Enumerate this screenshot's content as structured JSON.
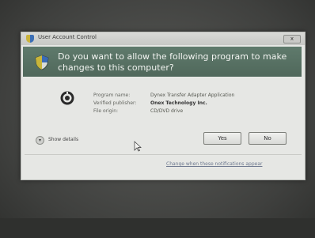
{
  "window": {
    "title": "User Account Control",
    "close_label": "x"
  },
  "banner": {
    "question": "Do you want to allow the following program to make changes to this computer?"
  },
  "details": {
    "labels": [
      "Program name:",
      "Verified publisher:",
      "File origin:"
    ],
    "program_name": "Dynex Transfer Adapter Application",
    "publisher": "Onex Technology Inc.",
    "file_origin": "CD/DVD drive"
  },
  "footer": {
    "show_details_label": "Show details",
    "yes_label": "Yes",
    "no_label": "No",
    "notifications_link": "Change when these notifications appear"
  },
  "colors": {
    "banner": "#5a7465",
    "window": "#e6e7e4",
    "background": "#4b4c4a"
  },
  "icons": [
    "shield-icon",
    "program-icon",
    "chevron-down-icon",
    "cursor-icon"
  ]
}
